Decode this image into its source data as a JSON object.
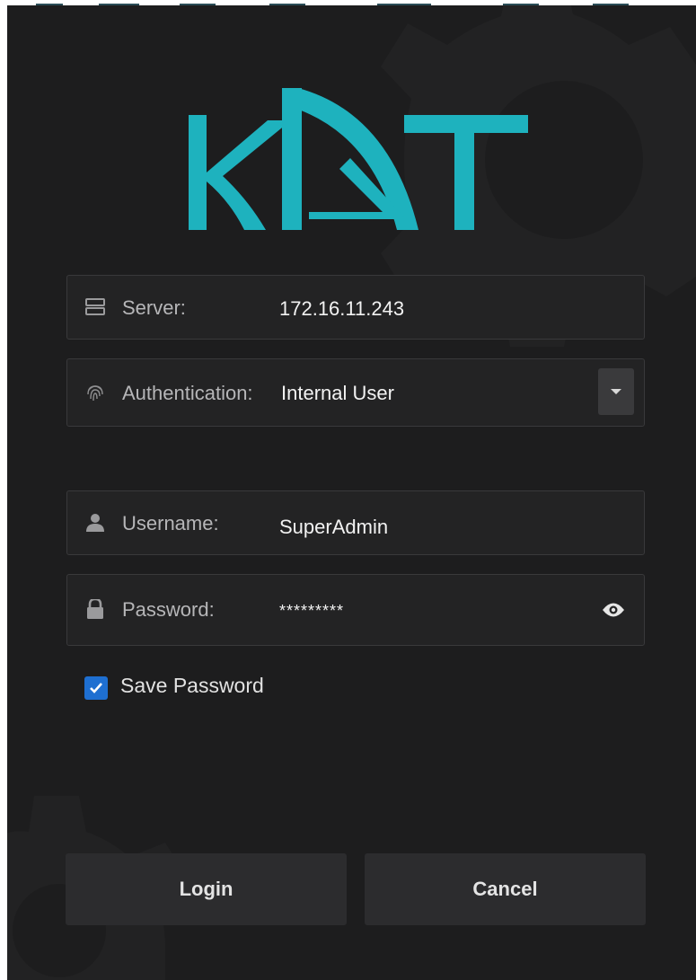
{
  "window": {
    "background": "#1d1d1e",
    "accent_color": "#1eb2be"
  },
  "logo": {
    "text": "KDT",
    "color": "#1eb2be"
  },
  "server": {
    "label": "Server:",
    "value": "172.16.11.243",
    "icon": "server-icon"
  },
  "authentication": {
    "label": "Authentication:",
    "value": "Internal User",
    "icon": "fingerprint-icon",
    "dropdown_icon": "caret-down-icon"
  },
  "username": {
    "label": "Username:",
    "value": "SuperAdmin",
    "icon": "user-icon"
  },
  "password": {
    "label": "Password:",
    "value": "*********",
    "icon": "lock-icon",
    "reveal_icon": "eye-icon"
  },
  "save_password": {
    "label": "Save Password",
    "checked": true,
    "checkbox_color": "#1e6fd1"
  },
  "buttons": {
    "login": "Login",
    "cancel": "Cancel"
  }
}
